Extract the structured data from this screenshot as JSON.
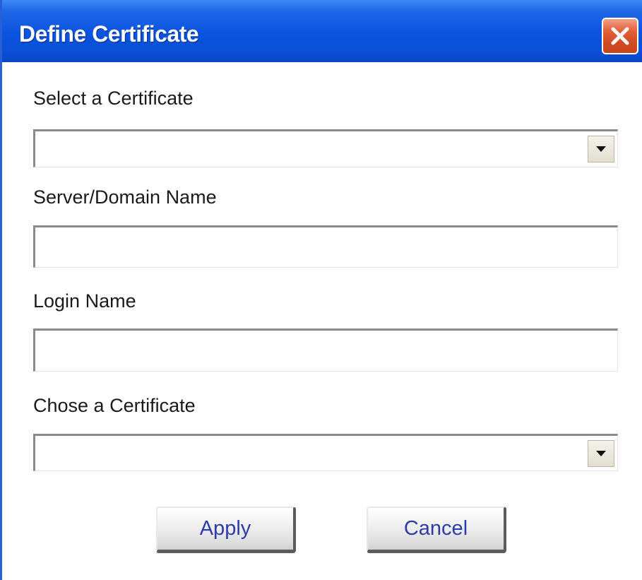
{
  "window": {
    "title": "Define Certificate"
  },
  "form": {
    "select_certificate": {
      "label": "Select a Certificate",
      "value": ""
    },
    "server_domain": {
      "label": "Server/Domain Name",
      "value": ""
    },
    "login_name": {
      "label": "Login Name",
      "value": ""
    },
    "chose_certificate": {
      "label": "Chose a Certificate",
      "value": ""
    }
  },
  "buttons": {
    "apply": "Apply",
    "cancel": "Cancel"
  },
  "icons": {
    "close": "close-icon",
    "dropdown": "dropdown-arrow-icon"
  },
  "colors": {
    "titlebar": "#0a54e0",
    "close_button": "#d24a22",
    "button_text": "#2c3ca8"
  }
}
